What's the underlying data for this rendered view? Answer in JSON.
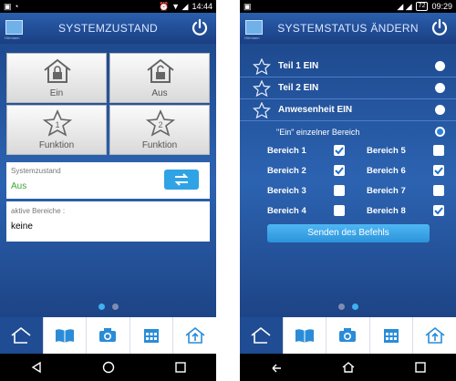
{
  "left": {
    "statusbar": {
      "time": "14:44"
    },
    "header": {
      "logo_text": "Hörmann",
      "title": "SYSTEMZUSTAND"
    },
    "tiles": [
      {
        "label": "Ein",
        "icon": "house-lock-closed-icon"
      },
      {
        "label": "Aus",
        "icon": "house-lock-open-icon"
      },
      {
        "label": "Funktion",
        "icon": "star-1-icon",
        "badge": "1"
      },
      {
        "label": "Funktion",
        "icon": "star-2-icon",
        "badge": "2"
      }
    ],
    "status_panel": {
      "state_caption": "Systemzustand",
      "state_value": "Aus",
      "state_color": "#3fa535",
      "areas_caption": "aktive Bereiche :",
      "areas_value": "keine"
    },
    "page_dots": {
      "count": 2,
      "active": 0
    }
  },
  "right": {
    "statusbar": {
      "battery": "72",
      "time": "09:29"
    },
    "header": {
      "logo_text": "Hörmann",
      "title": "SYSTEMSTATUS ÄNDERN"
    },
    "options": [
      {
        "label": "Teil 1 EIN",
        "selected": false
      },
      {
        "label": "Teil 2 EIN",
        "selected": false
      },
      {
        "label": "Anwesenheit EIN",
        "selected": false
      }
    ],
    "single_area": {
      "label": "\"Ein\" einzelner Bereich",
      "selected": true
    },
    "areas": [
      {
        "label": "Bereich 1",
        "checked": true
      },
      {
        "label": "Bereich 5",
        "checked": false
      },
      {
        "label": "Bereich 2",
        "checked": true
      },
      {
        "label": "Bereich 6",
        "checked": true
      },
      {
        "label": "Bereich 3",
        "checked": false
      },
      {
        "label": "Bereich 7",
        "checked": false
      },
      {
        "label": "Bereich 4",
        "checked": false
      },
      {
        "label": "Bereich 8",
        "checked": true
      }
    ],
    "send_button": "Senden des Befehls",
    "page_dots": {
      "count": 2,
      "active": 1
    }
  },
  "navbar_icons": [
    "home-icon",
    "book-icon",
    "camera-icon",
    "calendar-icon",
    "house-upload-icon"
  ],
  "colors": {
    "accent": "#2fa3e6",
    "header": "#1b3f82"
  }
}
